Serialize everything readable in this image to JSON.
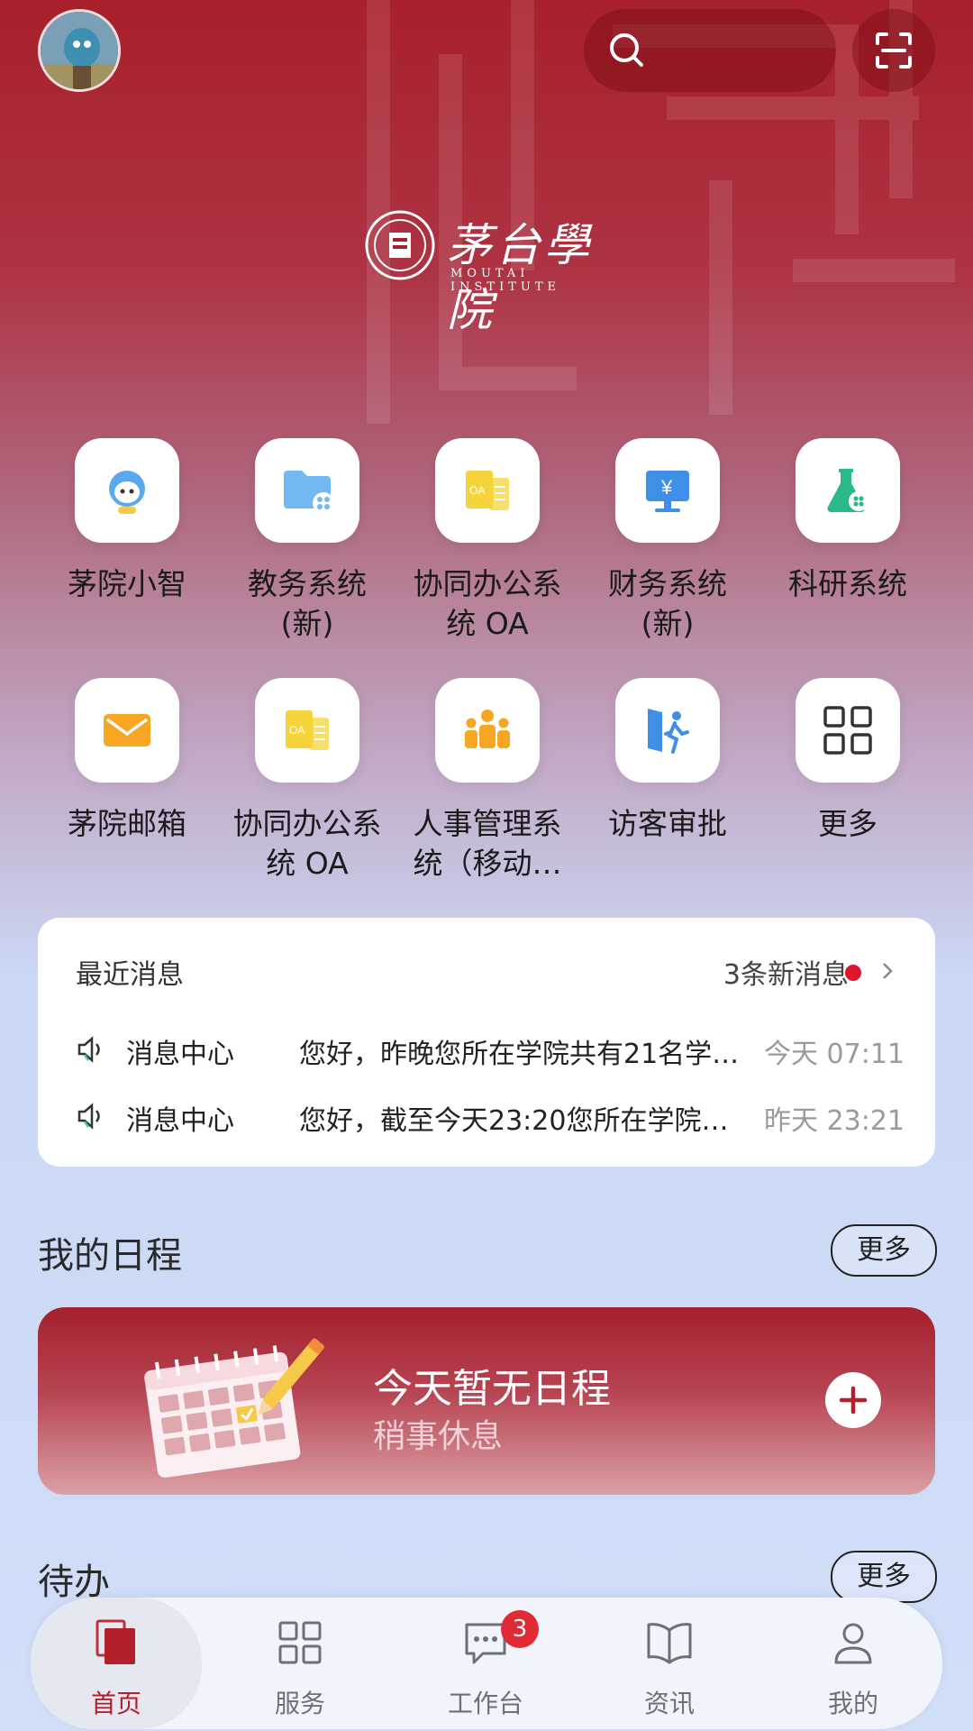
{
  "header": {
    "avatar_icon": "user-avatar",
    "search_icon": "search-icon",
    "scan_icon": "scan-icon"
  },
  "logo": {
    "name": "茅台學院",
    "subtitle": "MOUTAI INSTITUTE"
  },
  "apps": [
    {
      "label": "茅院小智",
      "icon": "robot-icon"
    },
    {
      "label": "教务系统\n(新)",
      "icon": "folder-icon"
    },
    {
      "label": "协同办公系\n统 OA",
      "icon": "oa-doc-icon"
    },
    {
      "label": "财务系统\n(新)",
      "icon": "finance-monitor-icon"
    },
    {
      "label": "科研系统",
      "icon": "flask-icon"
    },
    {
      "label": "茅院邮箱",
      "icon": "mail-icon"
    },
    {
      "label": "协同办公系\n统 OA",
      "icon": "oa-doc-icon"
    },
    {
      "label": "人事管理系\n统（移动…",
      "icon": "people-icon"
    },
    {
      "label": "访客审批",
      "icon": "visitor-icon"
    },
    {
      "label": "更多",
      "icon": "grid-icon"
    }
  ],
  "messages": {
    "title": "最近消息",
    "new_count": "3条新消息",
    "items": [
      {
        "source": "消息中心",
        "text": "您好，昨晚您所在学院共有21名学…",
        "time": "今天 07:11"
      },
      {
        "source": "消息中心",
        "text": "您好，截至今天23:20您所在学院…",
        "time": "昨天 23:21"
      }
    ]
  },
  "schedule": {
    "title": "我的日程",
    "more": "更多",
    "empty_title": "今天暂无日程",
    "empty_sub": "稍事休息"
  },
  "todo": {
    "title": "待办",
    "more": "更多"
  },
  "nav": {
    "items": [
      {
        "label": "首页",
        "icon": "home-icon",
        "active": true
      },
      {
        "label": "服务",
        "icon": "grid-icon"
      },
      {
        "label": "工作台",
        "icon": "chat-icon",
        "badge": "3"
      },
      {
        "label": "资讯",
        "icon": "book-icon"
      },
      {
        "label": "我的",
        "icon": "person-icon"
      }
    ]
  },
  "colors": {
    "brand_red": "#a8202b",
    "badge_red": "#e02b35"
  }
}
